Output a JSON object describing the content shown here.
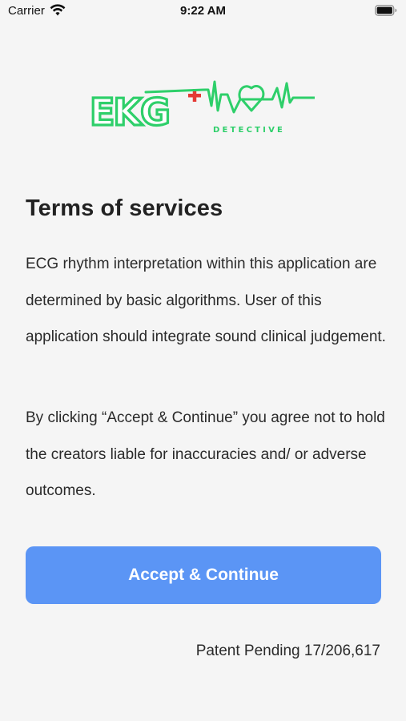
{
  "status_bar": {
    "carrier": "Carrier",
    "time": "9:22 AM",
    "wifi_icon": "wifi-icon",
    "battery_icon": "battery-icon"
  },
  "logo": {
    "text": "EKG",
    "subtext": "DETECTIVE",
    "brand_color": "#2ecf6a",
    "cross_color": "#e53935"
  },
  "terms": {
    "title": "Terms of services",
    "paragraph_1": "ECG rhythm interpretation within this application are determined by basic algorithms. User of this application should integrate sound clinical judgement.",
    "paragraph_2": "By clicking “Accept & Continue” you agree not to hold the creators liable for inaccuracies and/ or adverse outcomes."
  },
  "accept_button": {
    "label": "Accept & Continue",
    "color": "#5b95f5"
  },
  "footer": {
    "patent": "Patent Pending 17/206,617"
  }
}
